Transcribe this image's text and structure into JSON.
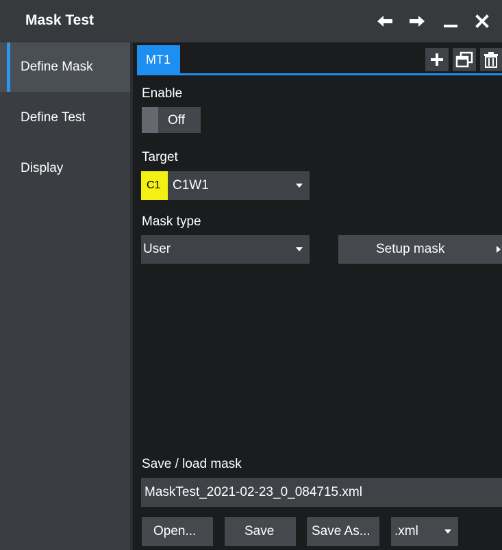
{
  "window": {
    "title": "Mask Test",
    "controls": [
      "arrow-left-icon",
      "arrow-right-icon",
      "minimize-icon",
      "close-icon"
    ]
  },
  "sidebar": {
    "items": [
      {
        "label": "Define Mask",
        "active": true
      },
      {
        "label": "Define Test",
        "active": false
      },
      {
        "label": "Display",
        "active": false
      }
    ]
  },
  "tabs": {
    "items": [
      {
        "label": "MT1",
        "active": true
      }
    ],
    "tools": [
      "add-icon",
      "copy-icon",
      "trash-icon"
    ]
  },
  "enable": {
    "label": "Enable",
    "state": "Off"
  },
  "target": {
    "label": "Target",
    "chip": "C1",
    "value": "C1W1"
  },
  "mask_type": {
    "label": "Mask type",
    "value": "User",
    "setup_label": "Setup mask"
  },
  "save_load": {
    "label": "Save / load mask",
    "filename": "MaskTest_2021-02-23_0_084715.xml",
    "open_label": "Open...",
    "save_label": "Save",
    "save_as_label": "Save As...",
    "format": ".xml"
  },
  "colors": {
    "accent": "#1c8ff0",
    "channel_c1": "#f3f014",
    "titlebar": "#37393d",
    "sidebar": "#3a3d42"
  }
}
